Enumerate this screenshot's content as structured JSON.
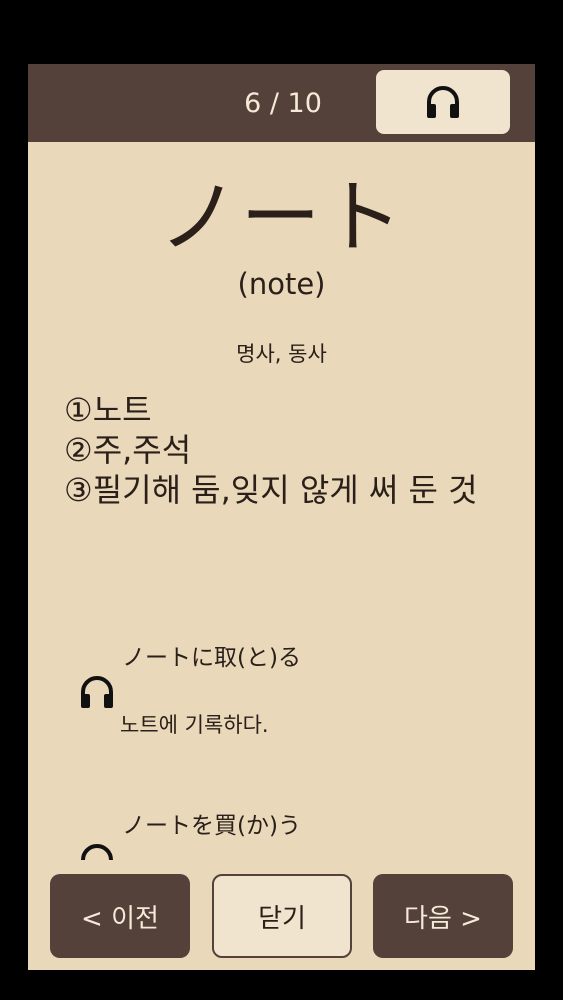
{
  "header": {
    "counter": "6 / 10",
    "audio_icon": "headphones-icon"
  },
  "card": {
    "word": "ノート",
    "reading": "(note)",
    "part_of_speech": "명사, 동사",
    "meanings": [
      "①노트",
      "②주,주석",
      "③필기해 둠,잊지 않게 써 둔 것"
    ]
  },
  "examples": [
    {
      "japanese": "ノートに取(と)る",
      "korean": "노트에 기록하다.",
      "icon": "headphones-icon"
    },
    {
      "japanese": "ノートを買(か)う",
      "korean": "",
      "icon": "headphones-icon"
    }
  ],
  "footer": {
    "prev_label": "< 이전",
    "close_label": "닫기",
    "next_label": "다음 >"
  },
  "colors": {
    "background": "#ead8bb",
    "bar": "#53413a",
    "button_light": "#f1e4ce",
    "text": "#2a2019"
  }
}
